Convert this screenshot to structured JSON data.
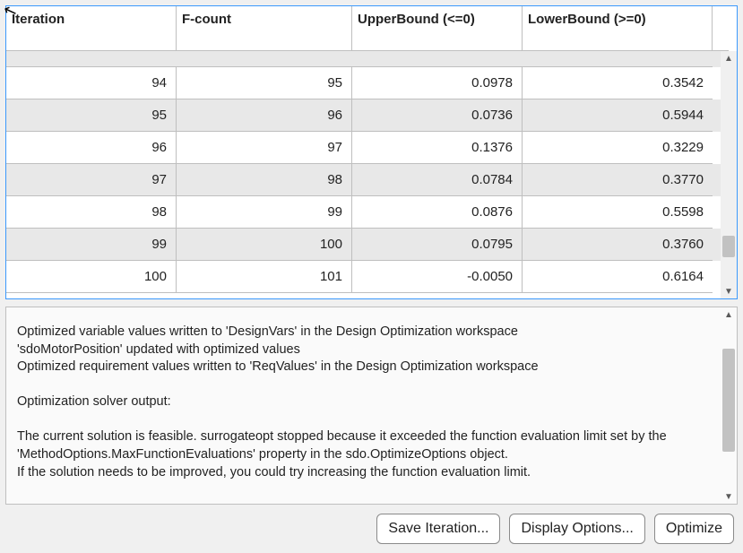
{
  "table": {
    "headers": {
      "iteration": "Iteration",
      "fcount": "F-count",
      "upperbound": "UpperBound (<=0)",
      "lowerbound": "LowerBound (>=0)"
    },
    "rows": [
      {
        "iteration": "94",
        "fcount": "95",
        "upperbound": "0.0978",
        "lowerbound": "0.3542"
      },
      {
        "iteration": "95",
        "fcount": "96",
        "upperbound": "0.0736",
        "lowerbound": "0.5944"
      },
      {
        "iteration": "96",
        "fcount": "97",
        "upperbound": "0.1376",
        "lowerbound": "0.3229"
      },
      {
        "iteration": "97",
        "fcount": "98",
        "upperbound": "0.0784",
        "lowerbound": "0.3770"
      },
      {
        "iteration": "98",
        "fcount": "99",
        "upperbound": "0.0876",
        "lowerbound": "0.5598"
      },
      {
        "iteration": "99",
        "fcount": "100",
        "upperbound": "0.0795",
        "lowerbound": "0.3760"
      },
      {
        "iteration": "100",
        "fcount": "101",
        "upperbound": "-0.0050",
        "lowerbound": "0.6164"
      }
    ]
  },
  "log": {
    "text": "Optimized variable values written to 'DesignVars' in the Design Optimization workspace\n'sdoMotorPosition' updated with optimized values\nOptimized requirement values written to 'ReqValues' in the Design Optimization workspace\n\nOptimization solver output:\n\nThe current solution is feasible. surrogateopt stopped because it exceeded the function evaluation limit set by the 'MethodOptions.MaxFunctionEvaluations' property in the sdo.OptimizeOptions object.\nIf the solution needs to be improved, you could try increasing the function evaluation limit."
  },
  "buttons": {
    "save_iteration": "Save Iteration...",
    "display_options": "Display Options...",
    "optimize": "Optimize"
  }
}
